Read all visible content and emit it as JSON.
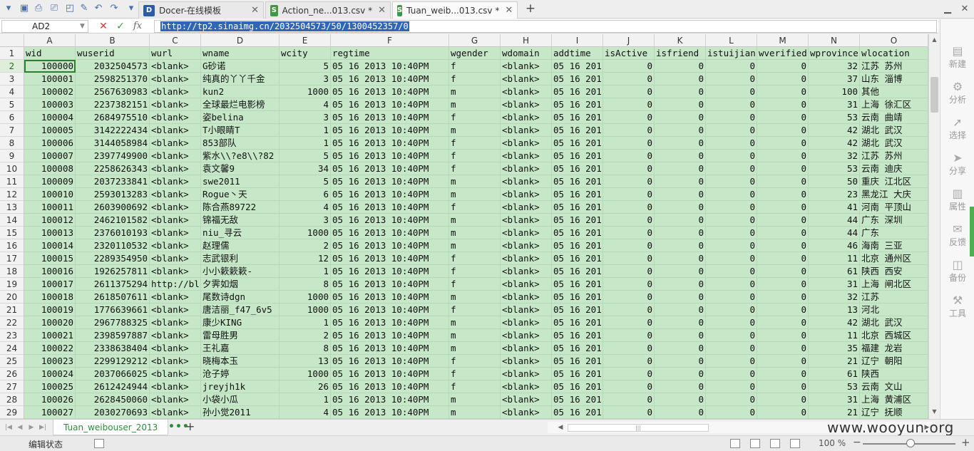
{
  "tabs": [
    {
      "label": "Docer-在线模板",
      "icon_text": "D",
      "icon_color": "#2b5aa8"
    },
    {
      "label": "Action_ne...013.csv *",
      "icon_text": "S",
      "icon_color": "#3a9a45"
    },
    {
      "label": "Tuan_weib...013.csv *",
      "icon_text": "S",
      "icon_color": "#3a9a45",
      "active": true
    }
  ],
  "namebox": "AD2",
  "formula_icons": {
    "cancel": "✕",
    "confirm": "✓",
    "fx": "fx"
  },
  "formula": "http://tp2.sinaimg.cn/2032504573/50/1300452357/0",
  "columns": [
    {
      "letter": "A",
      "name": "wid",
      "numeric": true
    },
    {
      "letter": "B",
      "name": "wuserid",
      "numeric": true
    },
    {
      "letter": "C",
      "name": "wurl",
      "numeric": false
    },
    {
      "letter": "D",
      "name": "wname",
      "numeric": false
    },
    {
      "letter": "E",
      "name": "wcity",
      "numeric": true
    },
    {
      "letter": "F",
      "name": "regtime",
      "numeric": false
    },
    {
      "letter": "G",
      "name": "wgender",
      "numeric": false
    },
    {
      "letter": "H",
      "name": "wdomain",
      "numeric": false
    },
    {
      "letter": "I",
      "name": "addtime",
      "numeric": false
    },
    {
      "letter": "J",
      "name": "isActive",
      "numeric": true
    },
    {
      "letter": "K",
      "name": "isfriend",
      "numeric": true
    },
    {
      "letter": "L",
      "name": "istuijian",
      "numeric": true
    },
    {
      "letter": "M",
      "name": "wverified",
      "numeric": true
    },
    {
      "letter": "N",
      "name": "wprovince",
      "numeric": true
    },
    {
      "letter": "O",
      "name": "wlocation",
      "numeric": false
    }
  ],
  "rows": [
    [
      "100000",
      "2032504573",
      "<blank>",
      "G砂诺",
      "5",
      "05 16 2013 10:40PM",
      "f",
      "<blank>",
      "05 16 201",
      "0",
      "0",
      "0",
      "0",
      "32",
      "江苏 苏州"
    ],
    [
      "100001",
      "2598251370",
      "<blank>",
      "纯真的丫丫千金",
      "3",
      "05 16 2013 10:40PM",
      "f",
      "<blank>",
      "05 16 201",
      "0",
      "0",
      "0",
      "0",
      "37",
      "山东 淄博"
    ],
    [
      "100002",
      "2567630983",
      "<blank>",
      "kun2",
      "1000",
      "05 16 2013 10:40PM",
      "m",
      "<blank>",
      "05 16 201",
      "0",
      "0",
      "0",
      "0",
      "100",
      "其他"
    ],
    [
      "100003",
      "2237382151",
      "<blank>",
      "全球最烂电影榜",
      "4",
      "05 16 2013 10:40PM",
      "m",
      "<blank>",
      "05 16 201",
      "0",
      "0",
      "0",
      "0",
      "31",
      "上海 徐汇区"
    ],
    [
      "100004",
      "2684975510",
      "<blank>",
      "姿belina",
      "3",
      "05 16 2013 10:40PM",
      "f",
      "<blank>",
      "05 16 201",
      "0",
      "0",
      "0",
      "0",
      "53",
      "云南 曲靖"
    ],
    [
      "100005",
      "3142222434",
      "<blank>",
      "T小眼睛T",
      "1",
      "05 16 2013 10:40PM",
      "m",
      "<blank>",
      "05 16 201",
      "0",
      "0",
      "0",
      "0",
      "42",
      "湖北 武汉"
    ],
    [
      "100006",
      "3144058984",
      "<blank>",
      "853部队",
      "1",
      "05 16 2013 10:40PM",
      "f",
      "<blank>",
      "05 16 201",
      "0",
      "0",
      "0",
      "0",
      "42",
      "湖北 武汉"
    ],
    [
      "100007",
      "2397749900",
      "<blank>",
      "紫水\\\\?e8\\\\?82",
      "5",
      "05 16 2013 10:40PM",
      "f",
      "<blank>",
      "05 16 201",
      "0",
      "0",
      "0",
      "0",
      "32",
      "江苏 苏州"
    ],
    [
      "100008",
      "2258626343",
      "<blank>",
      "袁文馨9",
      "34",
      "05 16 2013 10:40PM",
      "f",
      "<blank>",
      "05 16 201",
      "0",
      "0",
      "0",
      "0",
      "53",
      "云南 迪庆"
    ],
    [
      "100009",
      "2037233841",
      "<blank>",
      "swe2011",
      "5",
      "05 16 2013 10:40PM",
      "m",
      "<blank>",
      "05 16 201",
      "0",
      "0",
      "0",
      "0",
      "50",
      "重庆 江北区"
    ],
    [
      "100010",
      "2593013283",
      "<blank>",
      "Rogue丶天",
      "6",
      "05 16 2013 10:40PM",
      "m",
      "<blank>",
      "05 16 201",
      "0",
      "0",
      "0",
      "0",
      "23",
      "黑龙江 大庆"
    ],
    [
      "100011",
      "2603900692",
      "<blank>",
      "陈合燕89722",
      "4",
      "05 16 2013 10:40PM",
      "f",
      "<blank>",
      "05 16 201",
      "0",
      "0",
      "0",
      "0",
      "41",
      "河南 平顶山"
    ],
    [
      "100012",
      "2462101582",
      "<blank>",
      "锦福无敌",
      "3",
      "05 16 2013 10:40PM",
      "m",
      "<blank>",
      "05 16 201",
      "0",
      "0",
      "0",
      "0",
      "44",
      "广东 深圳"
    ],
    [
      "100013",
      "2376010193",
      "<blank>",
      "niu_寻云",
      "1000",
      "05 16 2013 10:40PM",
      "m",
      "<blank>",
      "05 16 201",
      "0",
      "0",
      "0",
      "0",
      "44",
      "广东"
    ],
    [
      "100014",
      "2320110532",
      "<blank>",
      "赵理儒",
      "2",
      "05 16 2013 10:40PM",
      "m",
      "<blank>",
      "05 16 201",
      "0",
      "0",
      "0",
      "0",
      "46",
      "海南 三亚"
    ],
    [
      "100015",
      "2289354950",
      "<blank>",
      "志武银利",
      "12",
      "05 16 2013 10:40PM",
      "f",
      "<blank>",
      "05 16 201",
      "0",
      "0",
      "0",
      "0",
      "11",
      "北京 通州区"
    ],
    [
      "100016",
      "1926257811",
      "<blank>",
      "小小簌簌簌-",
      "1",
      "05 16 2013 10:40PM",
      "f",
      "<blank>",
      "05 16 201",
      "0",
      "0",
      "0",
      "0",
      "61",
      "陕西 西安"
    ],
    [
      "100017",
      "2611375294",
      "http://bl",
      "夕霁如烟",
      "8",
      "05 16 2013 10:40PM",
      "f",
      "<blank>",
      "05 16 201",
      "0",
      "0",
      "0",
      "0",
      "31",
      "上海 闸北区"
    ],
    [
      "100018",
      "2618507611",
      "<blank>",
      "尾数诗dgn",
      "1000",
      "05 16 2013 10:40PM",
      "m",
      "<blank>",
      "05 16 201",
      "0",
      "0",
      "0",
      "0",
      "32",
      "江苏"
    ],
    [
      "100019",
      "1776639661",
      "<blank>",
      "唐洁丽_f47_6v5",
      "1000",
      "05 16 2013 10:40PM",
      "f",
      "<blank>",
      "05 16 201",
      "0",
      "0",
      "0",
      "0",
      "13",
      "河北"
    ],
    [
      "100020",
      "2967788325",
      "<blank>",
      "康少KING",
      "1",
      "05 16 2013 10:40PM",
      "m",
      "<blank>",
      "05 16 201",
      "0",
      "0",
      "0",
      "0",
      "42",
      "湖北 武汉"
    ],
    [
      "100021",
      "2398597887",
      "<blank>",
      "雷母胜男",
      "2",
      "05 16 2013 10:40PM",
      "m",
      "<blank>",
      "05 16 201",
      "0",
      "0",
      "0",
      "0",
      "11",
      "北京 西城区"
    ],
    [
      "100022",
      "2338638404",
      "<blank>",
      "王礼嘉",
      "8",
      "05 16 2013 10:40PM",
      "m",
      "<blank>",
      "05 16 201",
      "0",
      "0",
      "0",
      "0",
      "35",
      "福建 龙岩"
    ],
    [
      "100023",
      "2299129212",
      "<blank>",
      "晓梅本玉",
      "13",
      "05 16 2013 10:40PM",
      "f",
      "<blank>",
      "05 16 201",
      "0",
      "0",
      "0",
      "0",
      "21",
      "辽宁 朝阳"
    ],
    [
      "100024",
      "2037066025",
      "<blank>",
      "沧子婷",
      "1000",
      "05 16 2013 10:40PM",
      "f",
      "<blank>",
      "05 16 201",
      "0",
      "0",
      "0",
      "0",
      "61",
      "陕西"
    ],
    [
      "100025",
      "2612424944",
      "<blank>",
      "jreyjh1k",
      "26",
      "05 16 2013 10:40PM",
      "f",
      "<blank>",
      "05 16 201",
      "0",
      "0",
      "0",
      "0",
      "53",
      "云南 文山"
    ],
    [
      "100026",
      "2628450060",
      "<blank>",
      "小袋小瓜",
      "1",
      "05 16 2013 10:40PM",
      "m",
      "<blank>",
      "05 16 201",
      "0",
      "0",
      "0",
      "0",
      "31",
      "上海 黄浦区"
    ],
    [
      "100027",
      "2030270693",
      "<blank>",
      "孙小觉2011",
      "4",
      "05 16 2013 10:40PM",
      "m",
      "<blank>",
      "05 16 201",
      "0",
      "0",
      "0",
      "0",
      "21",
      "辽宁 抚顺"
    ]
  ],
  "side_panel": [
    {
      "label": "新建",
      "icon": "new-doc-icon",
      "glyph": "▤"
    },
    {
      "label": "分析",
      "icon": "analysis-icon",
      "glyph": "⚙"
    },
    {
      "label": "选择",
      "icon": "cursor-icon",
      "glyph": "➚"
    },
    {
      "label": "分享",
      "icon": "share-icon",
      "glyph": "➤"
    },
    {
      "label": "属性",
      "icon": "properties-icon",
      "glyph": "▥"
    },
    {
      "label": "反馈",
      "icon": "feedback-icon",
      "glyph": "✉"
    },
    {
      "label": "备份",
      "icon": "backup-icon",
      "glyph": "◫"
    },
    {
      "label": "工具",
      "icon": "toolbox-icon",
      "glyph": "⚒"
    }
  ],
  "sheet_tab": "Tuan_weibouser_2013",
  "sheet_more": "•••",
  "status_text": "编辑状态",
  "zoom": "100 %",
  "watermark": "www.wooyun.org",
  "accent_color": "#2e8b3a",
  "grid_bg": "#c6e7c8"
}
